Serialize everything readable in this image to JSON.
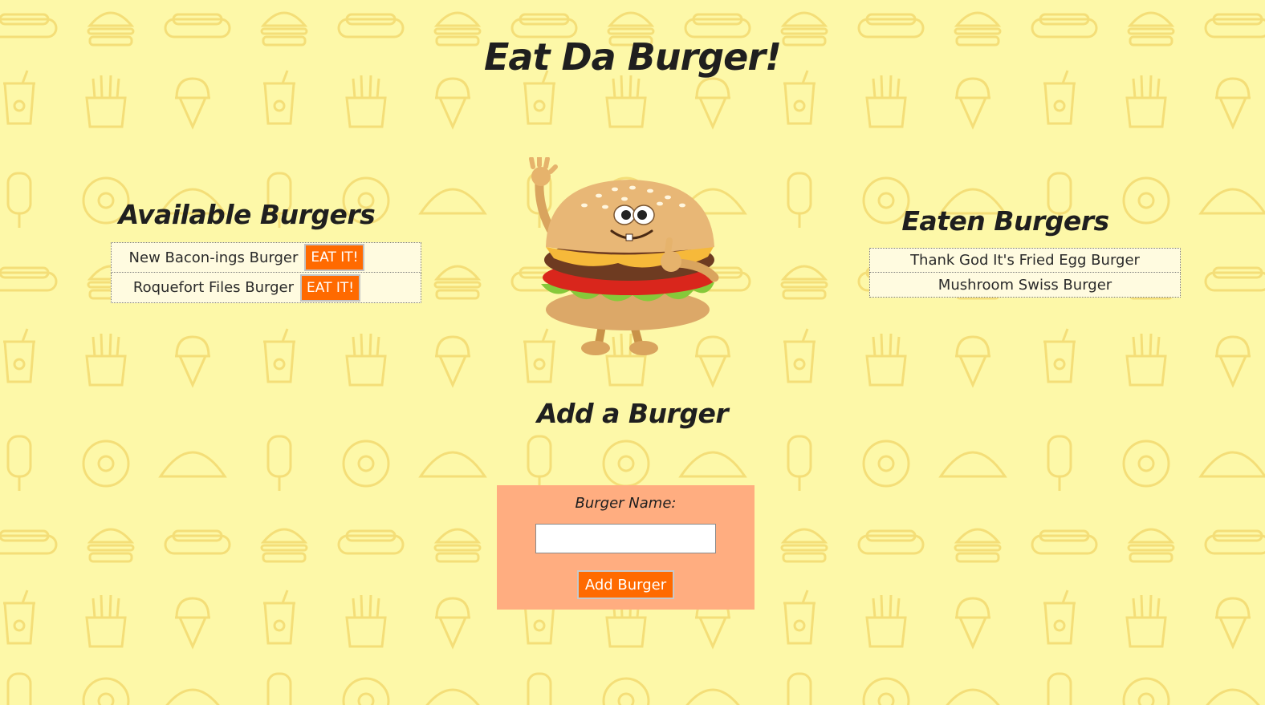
{
  "page": {
    "title": "Eat Da Burger!"
  },
  "available": {
    "heading": "Available Burgers",
    "burgers": [
      {
        "name": "New Bacon-ings Burger",
        "button_label": "EAT IT!"
      },
      {
        "name": "Roquefort Files Burger",
        "button_label": "EAT IT!"
      }
    ]
  },
  "eaten": {
    "heading": "Eaten Burgers",
    "burgers": [
      {
        "name": "Thank God It's Fried Egg Burger"
      },
      {
        "name": "Mushroom Swiss Burger"
      }
    ]
  },
  "add": {
    "heading": "Add a Burger",
    "label": "Burger Name:",
    "input_value": "",
    "button_label": "Add Burger"
  },
  "colors": {
    "background": "#fdf8a8",
    "pattern": "#f6e07a",
    "accent_button": "#ff6a00",
    "form_background": "#ffad80",
    "list_row": "#fffbe0"
  },
  "icons": {
    "mascot": "burger-mascot-icon",
    "pattern": [
      "hotdog-icon",
      "burger-icon",
      "soda-cup-icon",
      "fries-icon",
      "ice-cream-cone-icon",
      "popsicle-icon",
      "taco-icon",
      "donut-icon"
    ]
  }
}
